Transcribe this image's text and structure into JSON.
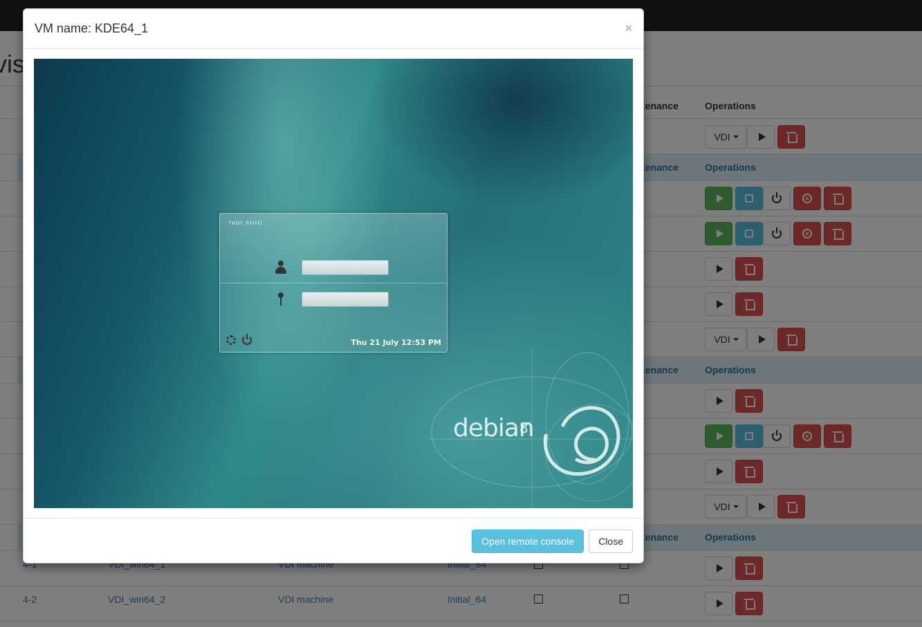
{
  "background": {
    "heading_fragment": "vis",
    "sections": [
      {
        "maintenance_header": "tenance",
        "operations_header": "Operations"
      },
      {
        "maintenance_header": "tenance",
        "operations_header": "Operations"
      },
      {
        "maintenance_header": "tenance",
        "operations_header": "Operations"
      },
      {
        "maintenance_header": "tenance",
        "operations_header": "Operations"
      }
    ],
    "vdi_label": "VDI",
    "rows": [
      {
        "id": "4-1",
        "name": "VDI_win64_1",
        "type": "VDI machine",
        "template": "Initial_64"
      },
      {
        "id": "4-2",
        "name": "VDI_win64_2",
        "type": "VDI machine",
        "template": "Initial_64"
      }
    ]
  },
  "modal": {
    "title": "VM name: KDE64_1",
    "close_x": "×",
    "open_console_label": "Open remote console",
    "close_label": "Close"
  },
  "console": {
    "login_header": "ıvuı ʌııııı",
    "clock": "Thu 21 July 12:53 PM",
    "brand": "debian",
    "brand_version": "8"
  }
}
